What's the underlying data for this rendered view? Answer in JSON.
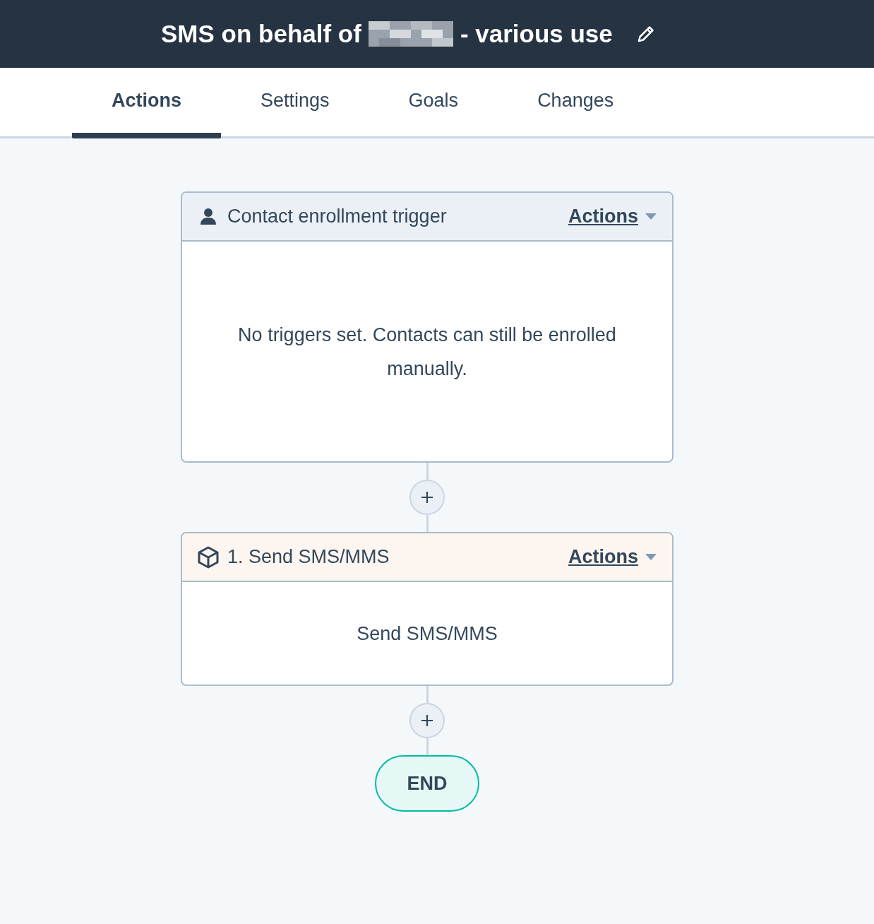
{
  "header": {
    "title_start": "SMS on behalf of",
    "redacted": true,
    "title_end": "- various use"
  },
  "tabs": [
    {
      "label": "Actions",
      "selected": true
    },
    {
      "label": "Settings",
      "selected": false
    },
    {
      "label": "Goals",
      "selected": false
    },
    {
      "label": "Changes",
      "selected": false
    }
  ],
  "steps": [
    {
      "kind": "trigger",
      "title": "Contact enrollment trigger",
      "menu": "Actions",
      "body": "No triggers set. Contacts can still be enrolled manually."
    },
    {
      "kind": "action",
      "title": "1. Send SMS/MMS",
      "menu": "Actions",
      "body": "Send SMS/MMS"
    }
  ],
  "end": "END"
}
